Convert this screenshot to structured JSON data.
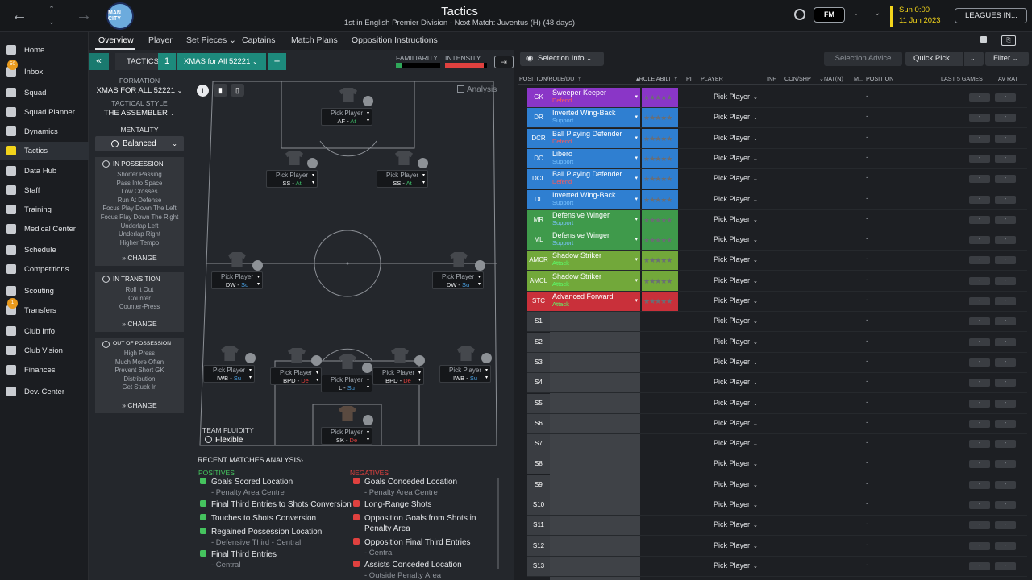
{
  "app": {
    "title": "Tactics",
    "subtitle": "1st in English Premier Division - Next Match: Juventus (H) (48 days)",
    "crest_text": "MAN CITY",
    "fm_label": "FM",
    "dash": "-",
    "time": "Sun 0:00",
    "date": "11 Jun 2023",
    "leagues_label": "LEAGUES IN..."
  },
  "sidebar": {
    "items": [
      {
        "label": "Home",
        "icon": "home-icon"
      },
      {
        "label": "Inbox",
        "icon": "inbox-icon",
        "badge": "50"
      },
      {
        "label": "Squad",
        "icon": "squad-icon"
      },
      {
        "label": "Squad Planner",
        "icon": "squad-planner-icon"
      },
      {
        "label": "Dynamics",
        "icon": "dynamics-icon"
      },
      {
        "label": "Tactics",
        "icon": "tactics-icon",
        "active": true
      },
      {
        "label": "Data Hub",
        "icon": "data-hub-icon"
      },
      {
        "label": "Staff",
        "icon": "staff-icon"
      },
      {
        "label": "Training",
        "icon": "training-icon"
      },
      {
        "label": "Medical Center",
        "icon": "medical-icon"
      },
      {
        "label": "Schedule",
        "icon": "calendar-icon"
      },
      {
        "label": "Competitions",
        "icon": "trophy-icon"
      },
      {
        "label": "Scouting",
        "icon": "scouting-icon"
      },
      {
        "label": "Transfers",
        "icon": "transfers-icon",
        "badge": "1"
      },
      {
        "label": "Club Info",
        "icon": "club-info-icon"
      },
      {
        "label": "Club Vision",
        "icon": "club-vision-icon"
      },
      {
        "label": "Finances",
        "icon": "finances-icon"
      },
      {
        "label": "Dev. Center",
        "icon": "dev-center-icon"
      }
    ]
  },
  "subnav": {
    "tabs": [
      "Overview",
      "Player",
      "Set Pieces",
      "Captains",
      "Match Plans",
      "Opposition Instructions"
    ],
    "set_pieces_arrow": "⌄"
  },
  "tactic": {
    "back": "«",
    "tactics_label": "TACTICS",
    "number": "1",
    "name": "XMAS for All 52221",
    "add": "+",
    "formation_label": "FORMATION",
    "formation": "XMAS FOR ALL 52221",
    "style_label": "TACTICAL STYLE",
    "style": "THE ASSEMBLER",
    "mentality_label": "MENTALITY",
    "mentality": "Balanced",
    "familiarity_label": "FAMILIARITY",
    "intensity_label": "INTENSITY",
    "change": "CHANGE"
  },
  "in_possession": {
    "title": "IN POSSESSION",
    "items": [
      "Shorter Passing",
      "Pass Into Space",
      "Low Crosses",
      "Run At Defense",
      "Focus Play Down The Left",
      "Focus Play Down The Right",
      "Underlap Left",
      "Underlap Right",
      "Higher Tempo"
    ]
  },
  "in_transition": {
    "title": "IN TRANSITION",
    "items": [
      "Roll It Out",
      "Counter",
      "Counter-Press"
    ]
  },
  "out_of_possession": {
    "title": "OUT OF POSSESSION",
    "items": [
      "High Press",
      "Much More Often",
      "Prevent Short GK",
      "Distribution",
      "Get Stuck In"
    ]
  },
  "pitch": {
    "analysis_label": "Analysis",
    "pick": "Pick Player",
    "positions": [
      {
        "role": "AF",
        "duty": "At",
        "dc": "#3ec06a"
      },
      {
        "role": "SS",
        "duty": "At",
        "dc": "#3ec06a"
      },
      {
        "role": "SS",
        "duty": "At",
        "dc": "#3ec06a"
      },
      {
        "role": "DW",
        "duty": "Su",
        "dc": "#4aa3e6"
      },
      {
        "role": "DW",
        "duty": "Su",
        "dc": "#4aa3e6"
      },
      {
        "role": "IWB",
        "duty": "Su",
        "dc": "#4aa3e6"
      },
      {
        "role": "BPD",
        "duty": "De",
        "dc": "#e0413f"
      },
      {
        "role": "L",
        "duty": "Su",
        "dc": "#4aa3e6"
      },
      {
        "role": "BPD",
        "duty": "De",
        "dc": "#e0413f"
      },
      {
        "role": "IWB",
        "duty": "Su",
        "dc": "#4aa3e6"
      },
      {
        "role": "SK",
        "duty": "De",
        "dc": "#e0413f"
      }
    ],
    "fluidity_label": "TEAM FLUIDITY",
    "fluidity": "Flexible"
  },
  "analysis": {
    "title": "RECENT MATCHES ANALYSIS",
    "title_arrow": "›",
    "positives_label": "POSITIVES",
    "negatives_label": "NEGATIVES",
    "positives": [
      {
        "t": "Goals Scored Location",
        "s": "- Penalty Area Centre"
      },
      {
        "t": "Final Third Entries to Shots Conversion"
      },
      {
        "t": "Touches to Shots Conversion"
      },
      {
        "t": "Regained Possession Location",
        "s": "- Defensive Third - Central"
      },
      {
        "t": "Final Third Entries",
        "s": "- Central"
      }
    ],
    "negatives": [
      {
        "t": "Goals Conceded Location",
        "s": "- Penalty Area Centre"
      },
      {
        "t": "Long-Range Shots"
      },
      {
        "t": "Opposition Goals from Shots in",
        "t2": "Penalty Area"
      },
      {
        "t": "Opposition Final Third Entries",
        "s": "- Central"
      },
      {
        "t": "Assists Conceded Location",
        "s": "- Outside Penalty Area"
      }
    ]
  },
  "selection": {
    "info_label": "Selection Info",
    "advice_label": "Selection Advice",
    "quickpick_label": "Quick Pick",
    "filter_label": "Filter"
  },
  "table": {
    "headers": [
      "POSITION/ROLE/DUTY",
      "ROLE ABILITY",
      "PI",
      "PLAYER",
      "INF",
      "CON/SHP",
      "NAT(N)",
      "M...",
      "POSITION",
      "LAST 5 GAMES",
      "AV RAT"
    ],
    "pick": "Pick Player",
    "dash": "-",
    "rows": [
      {
        "pos": "GK",
        "role": "Sweeper Keeper",
        "duty": "Defend",
        "color": "#8a36c7",
        "dcolor": "#ff5a5a"
      },
      {
        "pos": "DR",
        "role": "Inverted Wing-Back",
        "duty": "Support",
        "color": "#2f7fd1",
        "dcolor": "#7cc4ff"
      },
      {
        "pos": "DCR",
        "role": "Ball Playing Defender",
        "duty": "Defend",
        "color": "#2f7fd1",
        "dcolor": "#ff5a5a"
      },
      {
        "pos": "DC",
        "role": "Libero",
        "duty": "Support",
        "color": "#2f7fd1",
        "dcolor": "#7cc4ff"
      },
      {
        "pos": "DCL",
        "role": "Ball Playing Defender",
        "duty": "Defend",
        "color": "#2f7fd1",
        "dcolor": "#ff5a5a"
      },
      {
        "pos": "DL",
        "role": "Inverted Wing-Back",
        "duty": "Support",
        "color": "#2f7fd1",
        "dcolor": "#7cc4ff"
      },
      {
        "pos": "MR",
        "role": "Defensive Winger",
        "duty": "Support",
        "color": "#3f9a4b",
        "dcolor": "#7cc4ff"
      },
      {
        "pos": "ML",
        "role": "Defensive Winger",
        "duty": "Support",
        "color": "#3f9a4b",
        "dcolor": "#7cc4ff"
      },
      {
        "pos": "AMCR",
        "role": "Shadow Striker",
        "duty": "Attack",
        "color": "#72a83a",
        "dcolor": "#5bff6a"
      },
      {
        "pos": "AMCL",
        "role": "Shadow Striker",
        "duty": "Attack",
        "color": "#72a83a",
        "dcolor": "#5bff6a"
      },
      {
        "pos": "STC",
        "role": "Advanced Forward",
        "duty": "Attack",
        "color": "#c9303a",
        "dcolor": "#5bff6a"
      },
      {
        "pos": "S1"
      },
      {
        "pos": "S2"
      },
      {
        "pos": "S3"
      },
      {
        "pos": "S4"
      },
      {
        "pos": "S5"
      },
      {
        "pos": "S6"
      },
      {
        "pos": "S7"
      },
      {
        "pos": "S8"
      },
      {
        "pos": "S9"
      },
      {
        "pos": "S10"
      },
      {
        "pos": "S11"
      },
      {
        "pos": "S12"
      },
      {
        "pos": "S13"
      }
    ]
  },
  "colors": {
    "accent": "#1d8a7c",
    "highlight": "#f2d41b"
  }
}
